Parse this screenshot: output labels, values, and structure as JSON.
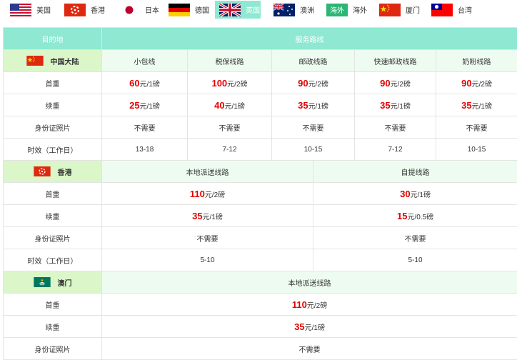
{
  "tabs": [
    {
      "label": "美国",
      "flag": "us-flag-icon",
      "active": false
    },
    {
      "label": "香港",
      "flag": "hk-flag-icon",
      "active": false
    },
    {
      "label": "日本",
      "flag": "jp-flag-icon",
      "active": false
    },
    {
      "label": "德国",
      "flag": "de-flag-icon",
      "active": false
    },
    {
      "label": "英国",
      "flag": "uk-flag-icon",
      "active": true
    },
    {
      "label": "澳洲",
      "flag": "au-flag-icon",
      "active": false
    },
    {
      "label": "海外",
      "flag": "overseas-badge-icon",
      "badge": "海外",
      "active": false
    },
    {
      "label": "厦门",
      "flag": "cn-flag-icon",
      "active": false
    },
    {
      "label": "台湾",
      "flag": "tw-flag-icon",
      "active": false
    }
  ],
  "header": {
    "dest": "目的地",
    "routes": "服务路线"
  },
  "row_labels": {
    "first": "首重",
    "extra": "续重",
    "id": "身份证照片",
    "time": "时效（工作日）"
  },
  "mainland": {
    "name": "中国大陆",
    "routes": [
      "小包线",
      "税保线路",
      "邮政线路",
      "快速邮政线路",
      "奶粉线路"
    ],
    "first": [
      {
        "n": "60",
        "u": "元/1磅"
      },
      {
        "n": "100",
        "u": "元/2磅"
      },
      {
        "n": "90",
        "u": "元/2磅"
      },
      {
        "n": "90",
        "u": "元/2磅"
      },
      {
        "n": "90",
        "u": "元/2磅"
      }
    ],
    "extra": [
      {
        "n": "25",
        "u": "元/1磅"
      },
      {
        "n": "40",
        "u": "元/1磅"
      },
      {
        "n": "35",
        "u": "元/1磅"
      },
      {
        "n": "35",
        "u": "元/1磅"
      },
      {
        "n": "35",
        "u": "元/1磅"
      }
    ],
    "id": [
      "不需要",
      "不需要",
      "不需要",
      "不需要",
      "不需要"
    ],
    "time": [
      "13-18",
      "7-12",
      "10-15",
      "7-12",
      "10-15"
    ]
  },
  "hongkong": {
    "name": "香港",
    "routes": [
      "本地派送线路",
      "自提线路"
    ],
    "first": [
      {
        "n": "110",
        "u": "元/2磅"
      },
      {
        "n": "30",
        "u": "元/1磅"
      }
    ],
    "extra": [
      {
        "n": "35",
        "u": "元/1磅"
      },
      {
        "n": "15",
        "u": "元/0.5磅"
      }
    ],
    "id": [
      "不需要",
      "不需要"
    ],
    "time": [
      "5-10",
      "5-10"
    ]
  },
  "macau": {
    "name": "澳门",
    "routes": [
      "本地派送线路"
    ],
    "first": [
      {
        "n": "110",
        "u": "元/2磅"
      }
    ],
    "extra": [
      {
        "n": "35",
        "u": "元/1磅"
      }
    ],
    "id": [
      "不需要"
    ]
  },
  "colors": {
    "header": "#8ee8d2",
    "region": "#dbf6c8",
    "route": "#eefbf0",
    "price": "#e50000"
  }
}
